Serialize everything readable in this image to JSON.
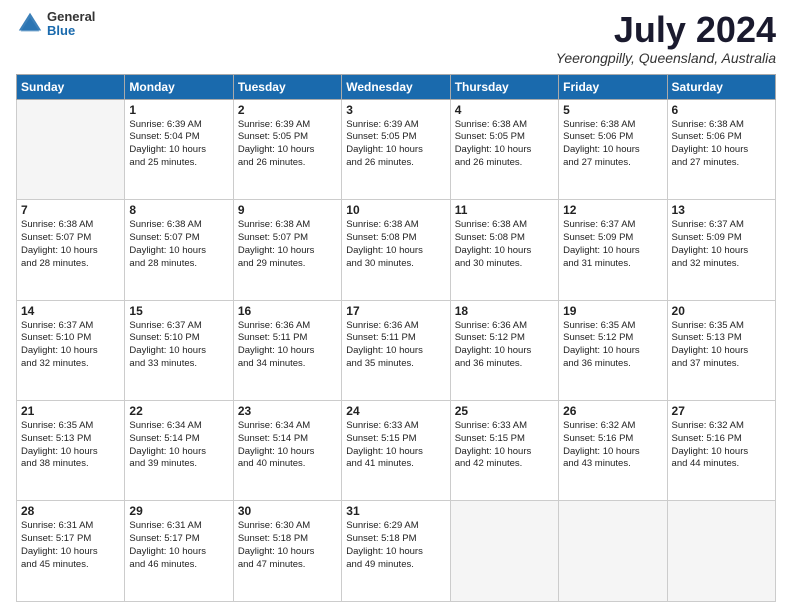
{
  "header": {
    "logo_general": "General",
    "logo_blue": "Blue",
    "month_title": "July 2024",
    "location": "Yeerongpilly, Queensland, Australia"
  },
  "days_of_week": [
    "Sunday",
    "Monday",
    "Tuesday",
    "Wednesday",
    "Thursday",
    "Friday",
    "Saturday"
  ],
  "weeks": [
    [
      {
        "day": "",
        "content": ""
      },
      {
        "day": "1",
        "content": "Sunrise: 6:39 AM\nSunset: 5:04 PM\nDaylight: 10 hours\nand 25 minutes."
      },
      {
        "day": "2",
        "content": "Sunrise: 6:39 AM\nSunset: 5:05 PM\nDaylight: 10 hours\nand 26 minutes."
      },
      {
        "day": "3",
        "content": "Sunrise: 6:39 AM\nSunset: 5:05 PM\nDaylight: 10 hours\nand 26 minutes."
      },
      {
        "day": "4",
        "content": "Sunrise: 6:38 AM\nSunset: 5:05 PM\nDaylight: 10 hours\nand 26 minutes."
      },
      {
        "day": "5",
        "content": "Sunrise: 6:38 AM\nSunset: 5:06 PM\nDaylight: 10 hours\nand 27 minutes."
      },
      {
        "day": "6",
        "content": "Sunrise: 6:38 AM\nSunset: 5:06 PM\nDaylight: 10 hours\nand 27 minutes."
      }
    ],
    [
      {
        "day": "7",
        "content": "Sunrise: 6:38 AM\nSunset: 5:07 PM\nDaylight: 10 hours\nand 28 minutes."
      },
      {
        "day": "8",
        "content": "Sunrise: 6:38 AM\nSunset: 5:07 PM\nDaylight: 10 hours\nand 28 minutes."
      },
      {
        "day": "9",
        "content": "Sunrise: 6:38 AM\nSunset: 5:07 PM\nDaylight: 10 hours\nand 29 minutes."
      },
      {
        "day": "10",
        "content": "Sunrise: 6:38 AM\nSunset: 5:08 PM\nDaylight: 10 hours\nand 30 minutes."
      },
      {
        "day": "11",
        "content": "Sunrise: 6:38 AM\nSunset: 5:08 PM\nDaylight: 10 hours\nand 30 minutes."
      },
      {
        "day": "12",
        "content": "Sunrise: 6:37 AM\nSunset: 5:09 PM\nDaylight: 10 hours\nand 31 minutes."
      },
      {
        "day": "13",
        "content": "Sunrise: 6:37 AM\nSunset: 5:09 PM\nDaylight: 10 hours\nand 32 minutes."
      }
    ],
    [
      {
        "day": "14",
        "content": "Sunrise: 6:37 AM\nSunset: 5:10 PM\nDaylight: 10 hours\nand 32 minutes."
      },
      {
        "day": "15",
        "content": "Sunrise: 6:37 AM\nSunset: 5:10 PM\nDaylight: 10 hours\nand 33 minutes."
      },
      {
        "day": "16",
        "content": "Sunrise: 6:36 AM\nSunset: 5:11 PM\nDaylight: 10 hours\nand 34 minutes."
      },
      {
        "day": "17",
        "content": "Sunrise: 6:36 AM\nSunset: 5:11 PM\nDaylight: 10 hours\nand 35 minutes."
      },
      {
        "day": "18",
        "content": "Sunrise: 6:36 AM\nSunset: 5:12 PM\nDaylight: 10 hours\nand 36 minutes."
      },
      {
        "day": "19",
        "content": "Sunrise: 6:35 AM\nSunset: 5:12 PM\nDaylight: 10 hours\nand 36 minutes."
      },
      {
        "day": "20",
        "content": "Sunrise: 6:35 AM\nSunset: 5:13 PM\nDaylight: 10 hours\nand 37 minutes."
      }
    ],
    [
      {
        "day": "21",
        "content": "Sunrise: 6:35 AM\nSunset: 5:13 PM\nDaylight: 10 hours\nand 38 minutes."
      },
      {
        "day": "22",
        "content": "Sunrise: 6:34 AM\nSunset: 5:14 PM\nDaylight: 10 hours\nand 39 minutes."
      },
      {
        "day": "23",
        "content": "Sunrise: 6:34 AM\nSunset: 5:14 PM\nDaylight: 10 hours\nand 40 minutes."
      },
      {
        "day": "24",
        "content": "Sunrise: 6:33 AM\nSunset: 5:15 PM\nDaylight: 10 hours\nand 41 minutes."
      },
      {
        "day": "25",
        "content": "Sunrise: 6:33 AM\nSunset: 5:15 PM\nDaylight: 10 hours\nand 42 minutes."
      },
      {
        "day": "26",
        "content": "Sunrise: 6:32 AM\nSunset: 5:16 PM\nDaylight: 10 hours\nand 43 minutes."
      },
      {
        "day": "27",
        "content": "Sunrise: 6:32 AM\nSunset: 5:16 PM\nDaylight: 10 hours\nand 44 minutes."
      }
    ],
    [
      {
        "day": "28",
        "content": "Sunrise: 6:31 AM\nSunset: 5:17 PM\nDaylight: 10 hours\nand 45 minutes."
      },
      {
        "day": "29",
        "content": "Sunrise: 6:31 AM\nSunset: 5:17 PM\nDaylight: 10 hours\nand 46 minutes."
      },
      {
        "day": "30",
        "content": "Sunrise: 6:30 AM\nSunset: 5:18 PM\nDaylight: 10 hours\nand 47 minutes."
      },
      {
        "day": "31",
        "content": "Sunrise: 6:29 AM\nSunset: 5:18 PM\nDaylight: 10 hours\nand 49 minutes."
      },
      {
        "day": "",
        "content": ""
      },
      {
        "day": "",
        "content": ""
      },
      {
        "day": "",
        "content": ""
      }
    ]
  ]
}
